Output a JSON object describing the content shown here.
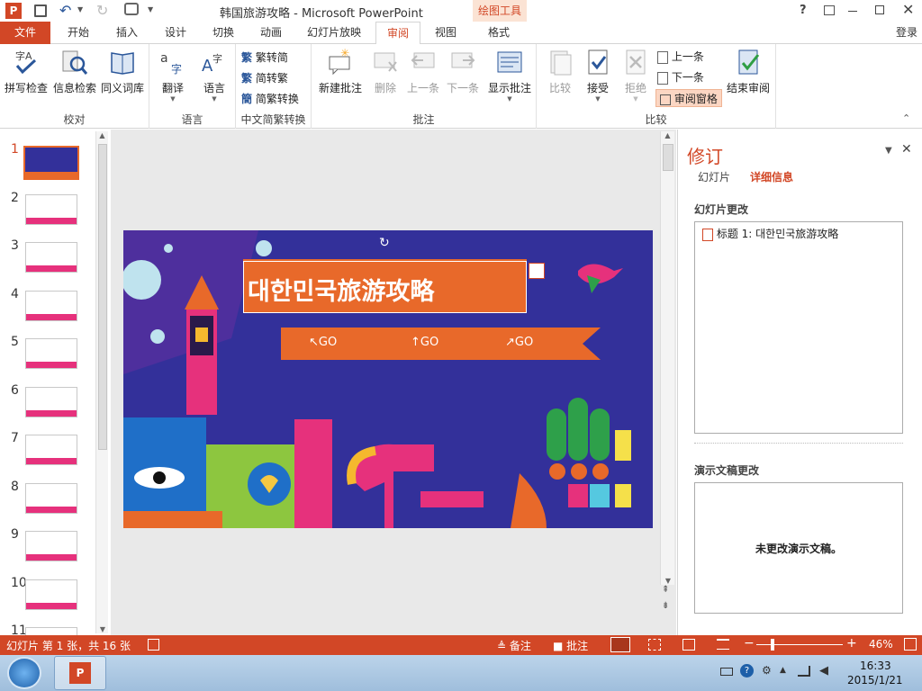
{
  "app": {
    "doc_title": "韩国旅游攻略 - Microsoft PowerPoint",
    "context_tab": "绘图工具",
    "help": "?",
    "login": "登录"
  },
  "tabs": [
    "文件",
    "开始",
    "插入",
    "设计",
    "切换",
    "动画",
    "幻灯片放映",
    "审阅",
    "视图",
    "格式"
  ],
  "ribbon": {
    "proof": {
      "label": "校对",
      "spell": "拼写检查",
      "research": "信息检索",
      "thesaurus": "同义词库"
    },
    "language": {
      "label": "语言",
      "translate": "翻译",
      "language": "语言"
    },
    "chinese": {
      "label": "中文简繁转换",
      "to_simp": "繁转简",
      "to_trad": "简转繁",
      "convert": "简繁转换"
    },
    "comments": {
      "label": "批注",
      "new": "新建批注",
      "delete": "删除",
      "prev": "上一条",
      "next": "下一条",
      "show": "显示批注"
    },
    "compare": {
      "label": "比较",
      "compare": "比较",
      "accept": "接受",
      "reject": "拒绝",
      "prev": "上一条",
      "next": "下一条",
      "pane": "审阅窗格",
      "end": "结束审阅"
    }
  },
  "thumbnails": [
    "1",
    "2",
    "3",
    "4",
    "5",
    "6",
    "7",
    "8",
    "9",
    "10",
    "11"
  ],
  "slide": {
    "title": "대한민국旅游攻略",
    "go1": "↖GO",
    "go2": "↑GO",
    "go3": "↗GO"
  },
  "revisions": {
    "title": "修订",
    "tab_slides": "幻灯片",
    "tab_details": "详细信息",
    "slide_changes": "幻灯片更改",
    "change_item": "标题 1: 대한민국旅游攻略",
    "doc_changes": "演示文稿更改",
    "no_changes": "未更改演示文稿。"
  },
  "status": {
    "slide_info": "幻灯片 第 1 张，共 16 张",
    "notes": "备注",
    "comments": "批注",
    "zoom": "46%"
  },
  "taskbar": {
    "time": "16:33",
    "date": "2015/1/21"
  },
  "colors": {
    "accent": "#d24726",
    "slide_bg": "#33309a",
    "banner": "#e8692a"
  }
}
